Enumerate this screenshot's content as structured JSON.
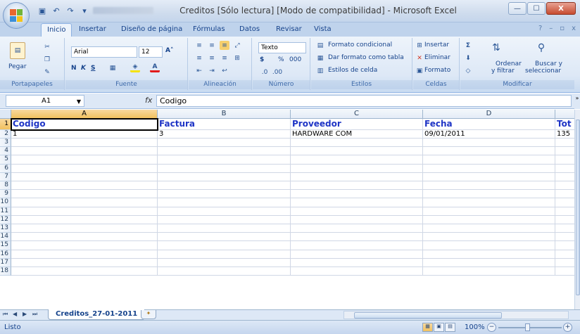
{
  "window": {
    "title": "Creditos  [Sólo lectura]  [Modo de compatibilidad] - Microsoft Excel",
    "minimize_label": "—",
    "maximize_label": "☐",
    "close_label": "X"
  },
  "qat": {
    "save_icon": "save-icon",
    "undo_icon": "undo-icon",
    "redo_icon": "redo-icon"
  },
  "ribbon_tabs": [
    "Inicio",
    "Insertar",
    "Diseño de página",
    "Fórmulas",
    "Datos",
    "Revisar",
    "Vista"
  ],
  "ribbon": {
    "clipboard": {
      "label": "Portapapeles",
      "paste": "Pegar"
    },
    "font": {
      "label": "Fuente",
      "name": "Arial",
      "size": "12",
      "bold": "N",
      "italic": "K",
      "underline": "S"
    },
    "alignment": {
      "label": "Alineación"
    },
    "number": {
      "label": "Número",
      "format": "Texto",
      "currency": "$",
      "percent": "%",
      "thousands": "000"
    },
    "styles": {
      "label": "Estilos",
      "conditional": "Formato condicional",
      "table": "Dar formato como tabla",
      "cell": "Estilos de celda"
    },
    "cells": {
      "label": "Celdas",
      "insert": "Insertar",
      "delete": "Eliminar",
      "format": "Formato"
    },
    "editing": {
      "label": "Modificar",
      "sort": "Ordenar",
      "sort2": "y filtrar",
      "find": "Buscar y",
      "find2": "seleccionar"
    }
  },
  "formula_bar": {
    "name_box": "A1",
    "fx": "fx",
    "value": "Codigo"
  },
  "columns": [
    "A",
    "B",
    "C",
    "D",
    ""
  ],
  "rows": [
    "1",
    "2",
    "3",
    "4",
    "5",
    "6",
    "7",
    "8",
    "9",
    "10",
    "11",
    "12",
    "13",
    "14",
    "15",
    "16",
    "17",
    "18"
  ],
  "cells": {
    "A1": "Codigo",
    "B1": "Factura",
    "C1": "Proveedor",
    "D1": "Fecha",
    "E1": "Tot",
    "A2": "1",
    "B2": "3",
    "C2": "HARDWARE COM",
    "D2": "09/01/2011",
    "E2": "135"
  },
  "sheet_tab": "Creditos_27-01-2011",
  "status": {
    "mode": "Listo",
    "zoom": "100%"
  }
}
